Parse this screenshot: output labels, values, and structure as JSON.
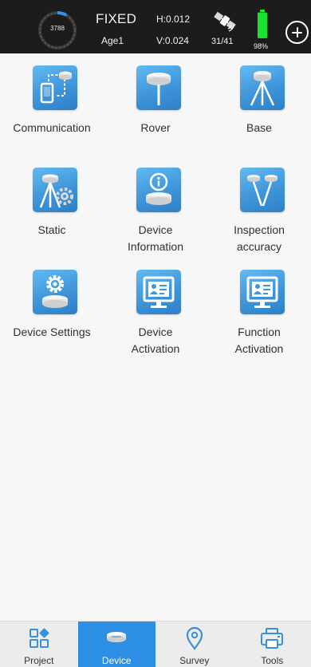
{
  "status_bar": {
    "satellite_ring_label": "3788",
    "fix_status": "FIXED",
    "age": "Age1",
    "h_precision": "H:0.012",
    "v_precision": "V:0.024",
    "satellites": "31/41",
    "battery_percent": "98%",
    "battery_level": 0.98,
    "colors": {
      "bar": "#1c1c1c",
      "ring": "#2e92e8",
      "battery": "#19e235"
    }
  },
  "menu": {
    "items": [
      {
        "label": "Communication",
        "icon": "communication-icon"
      },
      {
        "label": "Rover",
        "icon": "rover-icon"
      },
      {
        "label": "Base",
        "icon": "base-icon"
      },
      {
        "label": "Static",
        "icon": "static-icon"
      },
      {
        "label": "Device\nInformation",
        "icon": "device-information-icon"
      },
      {
        "label": "Inspection\naccuracy",
        "icon": "inspection-accuracy-icon"
      },
      {
        "label": "Device Settings",
        "icon": "device-settings-icon"
      },
      {
        "label": "Device\nActivation",
        "icon": "device-activation-icon"
      },
      {
        "label": "Function\nActivation",
        "icon": "function-activation-icon"
      }
    ],
    "tile_color": "#3f95d9"
  },
  "bottom_nav": {
    "tabs": [
      {
        "label": "Project",
        "icon": "project-icon"
      },
      {
        "label": "Device",
        "icon": "device-icon",
        "active": true
      },
      {
        "label": "Survey",
        "icon": "survey-icon"
      },
      {
        "label": "Tools",
        "icon": "tools-icon"
      }
    ],
    "active_color": "#2c8fe4",
    "icon_color": "#3a8fd8"
  }
}
